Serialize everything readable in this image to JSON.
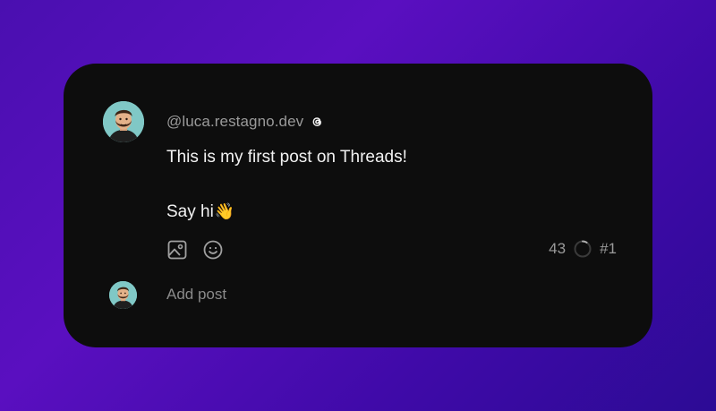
{
  "post": {
    "username": "@luca.restagno.dev",
    "verified_icon": "threads-logo-icon",
    "line1": "This is my first post on Threads!",
    "line2": "Say hi",
    "line2_emoji": "👋"
  },
  "toolbar": {
    "icons": [
      "image-icon",
      "emoji-icon"
    ],
    "char_count": "43",
    "progress_fraction": 0.09,
    "thread_index": "#1"
  },
  "composer": {
    "placeholder": "Add post"
  },
  "colors": {
    "card_background": "#0d0d0d",
    "accent_gradient_start": "#4a0fb0",
    "accent_gradient_end": "#2c0b95"
  }
}
